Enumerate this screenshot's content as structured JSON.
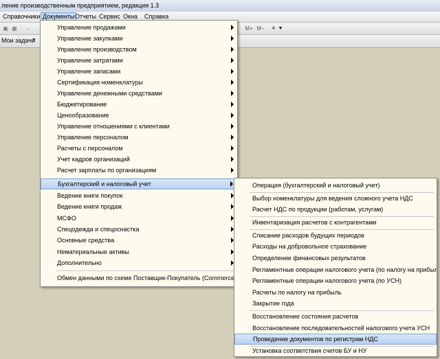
{
  "window": {
    "title": "ление производственным предприятием, редакция 1.3"
  },
  "menubar": {
    "items": [
      {
        "label": "Справочники"
      },
      {
        "label": "Документы"
      },
      {
        "label": "Отчеты"
      },
      {
        "label": "Сервис"
      },
      {
        "label": "Окна"
      },
      {
        "label": "Справка"
      }
    ]
  },
  "toolbar": {
    "m_plus": "M+",
    "m_minus": "M−"
  },
  "tasks": {
    "label": "Мои задачи"
  },
  "documents_menu": {
    "items": [
      {
        "label": "Управление продажами"
      },
      {
        "label": "Управление закупками"
      },
      {
        "label": "Управление производством"
      },
      {
        "label": "Управление затратами"
      },
      {
        "label": "Управление запасами"
      },
      {
        "label": "Сертификация номенклатуры"
      },
      {
        "label": "Управление денежными средствами"
      },
      {
        "label": "Бюджетирование"
      },
      {
        "label": "Ценообразование"
      },
      {
        "label": "Управление отношениями с клиентами"
      },
      {
        "label": "Управление персоналом"
      },
      {
        "label": "Расчеты с персоналом"
      },
      {
        "label": "Учет кадров организаций"
      },
      {
        "label": "Расчет зарплаты по организациям"
      },
      {
        "label": "Бухгалтерский и налоговый учет"
      },
      {
        "label": "Ведение книги покупок"
      },
      {
        "label": "Ведение книги продаж"
      },
      {
        "label": "МСФО"
      },
      {
        "label": "Спецодежда и спецоснастка"
      },
      {
        "label": "Основные средства"
      },
      {
        "label": "Нематериальные активы"
      },
      {
        "label": "Дополнительно"
      },
      {
        "label": "Обмен данными по схеме Поставщик-Покупатель (CommerceML)"
      }
    ]
  },
  "accounting_submenu": {
    "items": [
      {
        "label": "Операция (бухгалтерский и налоговый учет)"
      },
      {
        "label": "Выбор номенклатуры для ведения сложного учета НДС"
      },
      {
        "label": "Расчет НДС по продукции (работам, услугам)"
      },
      {
        "label": "Инвентаризация расчетов с контрагентами"
      },
      {
        "label": "Списание расходов будущих периодов"
      },
      {
        "label": "Расходы на добровольное страхование"
      },
      {
        "label": "Определение финансовых результатов"
      },
      {
        "label": "Регламентные операции налогового учета (по налогу на прибыль)"
      },
      {
        "label": "Регламентные операции налогового учета (по УСН)"
      },
      {
        "label": "Расчеты по налогу на прибыль"
      },
      {
        "label": "Закрытие года"
      },
      {
        "label": "Восстановление состояния расчетов"
      },
      {
        "label": "Восстановление последовательностей налогового учета УСН"
      },
      {
        "label": "Проведение документов по регистрам НДС"
      },
      {
        "label": "Установка соответствия счетов БУ и НУ"
      }
    ]
  }
}
